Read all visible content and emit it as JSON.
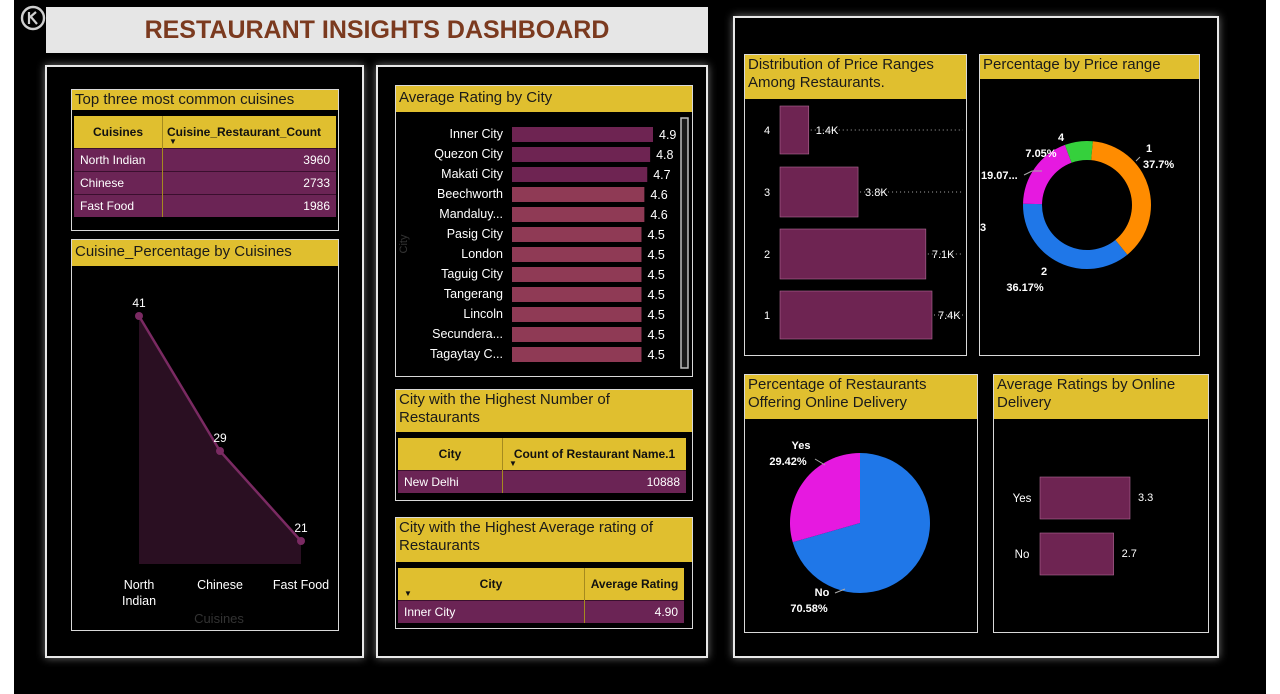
{
  "header": {
    "title": "RESTAURANT INSIGHTS DASHBOARD"
  },
  "colors": {
    "accent_yellow": "#e0bf2f",
    "bar_purple": "#6b2455",
    "title_brown": "#7b3a1f",
    "orange": "#ff8c00",
    "blue": "#1f77e8",
    "magenta": "#e619e0",
    "green": "#35d03c"
  },
  "top_cuisines": {
    "title": "Top three most common cuisines",
    "columns": [
      "Cuisines",
      "Cuisine_Restaurant_Count"
    ],
    "rows": [
      [
        "North Indian",
        "3960"
      ],
      [
        "Chinese",
        "2733"
      ],
      [
        "Fast Food",
        "1986"
      ]
    ]
  },
  "cuisine_percentage": {
    "title": "Cuisine_Percentage by Cuisines",
    "xlabel": "Cuisines",
    "chart_data": {
      "type": "area",
      "categories": [
        "North Indian",
        "Chinese",
        "Fast Food"
      ],
      "values": [
        41,
        29,
        21
      ],
      "xlabel": "Cuisines",
      "category_lines": [
        [
          "North",
          "Indian"
        ],
        [
          "Chinese"
        ],
        [
          "Fast Food"
        ]
      ]
    }
  },
  "avg_rating_city": {
    "title": "Average Rating by City",
    "ylabel": "City",
    "chart_data": {
      "type": "bar",
      "orientation": "horizontal",
      "categories": [
        "Inner City",
        "Quezon City",
        "Makati City",
        "Beechworth",
        "Mandaluy...",
        "Pasig City",
        "London",
        "Taguig City",
        "Tangerang",
        "Lincoln",
        "Secundera...",
        "Tagaytay C..."
      ],
      "values": [
        4.9,
        4.8,
        4.7,
        4.6,
        4.6,
        4.5,
        4.5,
        4.5,
        4.5,
        4.5,
        4.5,
        4.5
      ],
      "labels": [
        "4.9",
        "4.8",
        "4.7",
        "4.6",
        "4.6",
        "4.5",
        "4.5",
        "4.5",
        "4.5",
        "4.5",
        "4.5",
        "4.5"
      ]
    }
  },
  "highest_count_city": {
    "title": "City with the Highest Number of Restaurants",
    "columns": [
      "City",
      "Count of Restaurant Name.1"
    ],
    "rows": [
      [
        "New Delhi",
        "10888"
      ]
    ]
  },
  "highest_rating_city": {
    "title": "City with the Highest Average rating of Restaurants",
    "columns": [
      "City",
      "Average Rating"
    ],
    "rows": [
      [
        "Inner City",
        "4.90"
      ]
    ]
  },
  "price_distribution": {
    "title": "Distribution of Price Ranges Among Restaurants.",
    "chart_data": {
      "type": "bar",
      "orientation": "horizontal",
      "categories": [
        "4",
        "3",
        "2",
        "1"
      ],
      "values": [
        1400,
        3800,
        7100,
        7400
      ],
      "labels": [
        "1.4K",
        "3.8K",
        "7.1K",
        "7.4K"
      ]
    }
  },
  "price_percentage": {
    "title": "Percentage by Price range",
    "chart_data": {
      "type": "pie",
      "donut": true,
      "categories": [
        "1",
        "2",
        "3",
        "4"
      ],
      "values": [
        37.7,
        36.17,
        19.07,
        7.05
      ],
      "labels": [
        "37.7%",
        "36.17%",
        "19.07...",
        "7.05%"
      ]
    }
  },
  "online_delivery": {
    "title": "Percentage of Restaurants Offering Online Delivery",
    "chart_data": {
      "type": "pie",
      "categories": [
        "No",
        "Yes"
      ],
      "values": [
        70.58,
        29.42
      ],
      "labels": [
        "70.58%",
        "29.42%"
      ]
    }
  },
  "ratings_online": {
    "title": "Average Ratings by Online Delivery",
    "chart_data": {
      "type": "bar",
      "orientation": "horizontal",
      "categories": [
        "Yes",
        "No"
      ],
      "values": [
        3.3,
        2.7
      ],
      "labels": [
        "3.3",
        "2.7"
      ]
    }
  }
}
